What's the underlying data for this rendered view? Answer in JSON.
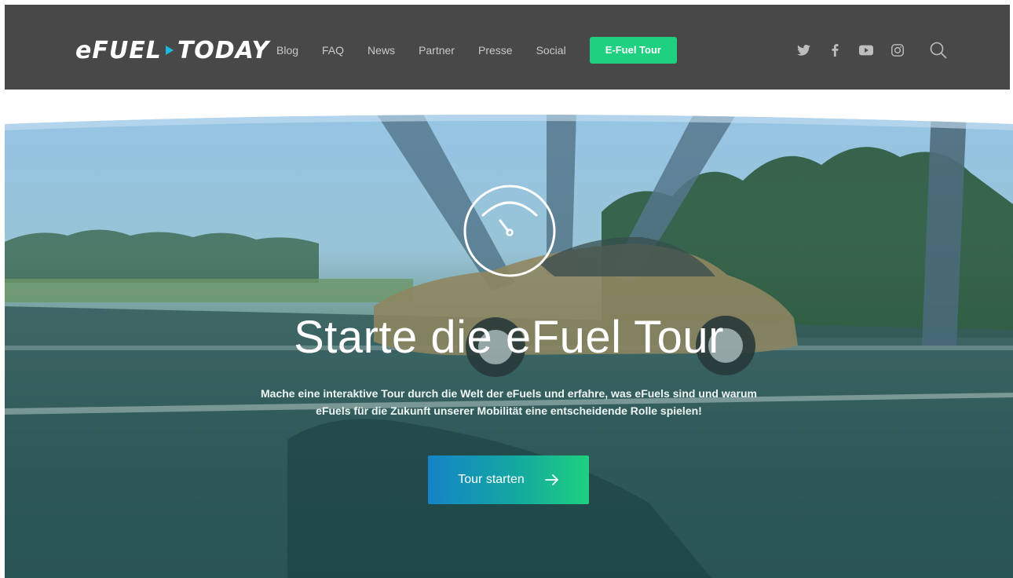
{
  "header": {
    "logo": {
      "part1": "eFUEL",
      "part2": "TODAY"
    },
    "nav": [
      {
        "label": "Blog"
      },
      {
        "label": "FAQ"
      },
      {
        "label": "News"
      },
      {
        "label": "Partner"
      },
      {
        "label": "Presse"
      },
      {
        "label": "Social"
      }
    ],
    "cta_label": "E-Fuel Tour",
    "social_icons": [
      "twitter-icon",
      "facebook-icon",
      "youtube-icon",
      "instagram-icon"
    ],
    "search_icon": "search-icon"
  },
  "hero": {
    "icon": "speedometer-icon",
    "title": "Starte die eFuel Tour",
    "text_line1": "Mache eine interaktive Tour durch die Welt der eFuels und erfahre, was eFuels sind und warum",
    "text_line2": "eFuels für die Zukunft unserer Mobilität eine entscheidende Rolle spielen!",
    "button_label": "Tour starten",
    "button_icon": "arrow-right-icon"
  },
  "colors": {
    "header_bg": "#484848",
    "nav_text": "#c9c9c9",
    "cta_green": "#1ed07f",
    "button_blue": "#1584c7",
    "logo_accent": "#1fb8e0"
  }
}
